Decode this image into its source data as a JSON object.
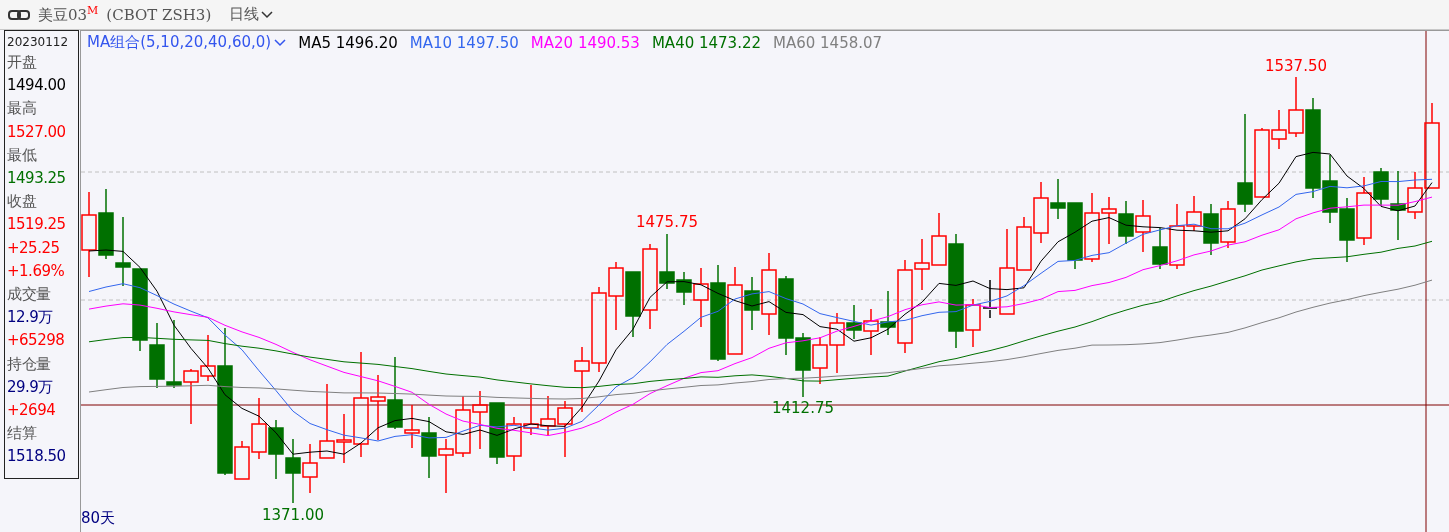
{
  "toolbar": {
    "title": "美豆03$^{M}$",
    "exchange": "(CBOT ZSH3)",
    "period": "日线"
  },
  "info_panel": {
    "date": "20230112",
    "fields": [
      {
        "text": "开盘",
        "kind": "label"
      },
      {
        "text": "1494.00",
        "kind": "value",
        "color": "#000000"
      },
      {
        "text": "最高",
        "kind": "label"
      },
      {
        "text": "1527.00",
        "kind": "value",
        "color": "#ff0000"
      },
      {
        "text": "最低",
        "kind": "label"
      },
      {
        "text": "1493.25",
        "kind": "value",
        "color": "#007000"
      },
      {
        "text": "收盘",
        "kind": "label"
      },
      {
        "text": "1519.25",
        "kind": "value",
        "color": "#ff0000"
      },
      {
        "text": "+25.25",
        "kind": "value",
        "color": "#ff0000"
      },
      {
        "text": "+1.69%",
        "kind": "value",
        "color": "#ff0000"
      },
      {
        "text": "成交量",
        "kind": "label"
      },
      {
        "text": "12.9万",
        "kind": "value",
        "color": "#000080"
      },
      {
        "text": "+65298",
        "kind": "value",
        "color": "#ff0000"
      },
      {
        "text": "持仓量",
        "kind": "label"
      },
      {
        "text": "29.9万",
        "kind": "value",
        "color": "#000080"
      },
      {
        "text": "+2694",
        "kind": "value",
        "color": "#ff0000"
      },
      {
        "text": "结算",
        "kind": "label"
      },
      {
        "text": "1518.50",
        "kind": "value",
        "color": "#000080"
      }
    ]
  },
  "legend": {
    "combo": "MA组合(5,10,20,40,60,0)",
    "lines": [
      {
        "label": "MA5",
        "value": "1496.20",
        "color": "#000000"
      },
      {
        "label": "MA10",
        "value": "1497.50",
        "color": "#3366ee"
      },
      {
        "label": "MA20",
        "value": "1490.53",
        "color": "#ff00ff"
      },
      {
        "label": "MA40",
        "value": "1473.22",
        "color": "#007000"
      },
      {
        "label": "MA60",
        "value": "1458.07",
        "color": "#808080"
      }
    ]
  },
  "chart": {
    "peak_labels": [
      {
        "text": "1537.50",
        "kind": "high"
      },
      {
        "text": "1475.75",
        "kind": "high"
      },
      {
        "text": "1412.75",
        "kind": "low"
      },
      {
        "text": "1371.00",
        "kind": "low"
      }
    ],
    "range_label": "80天"
  }
}
